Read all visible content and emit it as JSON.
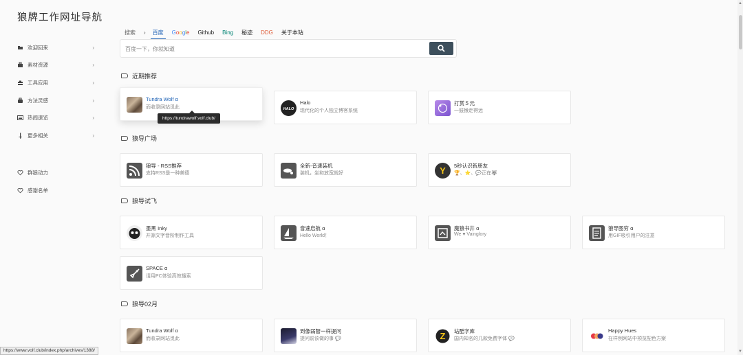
{
  "site": {
    "title": "狼牌工作网址导航"
  },
  "sidebar": {
    "items": [
      {
        "label": "欢迎回来",
        "icon": "bookmark-icon"
      },
      {
        "label": "素材资源",
        "icon": "briefcase-icon"
      },
      {
        "label": "工具应用",
        "icon": "toolbox-icon"
      },
      {
        "label": "方法灵感",
        "icon": "briefcase-icon"
      },
      {
        "label": "热闻速览",
        "icon": "list-icon"
      },
      {
        "label": "更多相关",
        "icon": "sword-icon"
      }
    ],
    "links": [
      {
        "label": "群狼动力",
        "icon": "heart-icon"
      },
      {
        "label": "感谢名单",
        "icon": "heart-icon"
      }
    ],
    "chevron": "›"
  },
  "search": {
    "lead": "搜索",
    "sep": "›",
    "tabs": [
      "百度",
      "Google",
      "Github",
      "Bing",
      "秘迹",
      "DDG",
      "关于本站"
    ],
    "placeholder": "百度一下，你就知道"
  },
  "sections": [
    {
      "title": "近期推荐",
      "cards": [
        {
          "title": "Tundra Wolf α",
          "desc": "而收录网站觅此",
          "icon": "wolf-photo-icon"
        },
        {
          "title": "Halo",
          "desc": "现代化的个人独立博客系统",
          "icon": "halo-icon"
        },
        {
          "title": "打赏５元",
          "desc": "一鼓猴走得远",
          "icon": "gift-icon"
        }
      ]
    },
    {
      "title": "狼导广场",
      "cards": [
        {
          "title": "狼导 - RSS推荐",
          "desc": "支持RSS是一种美德",
          "icon": "rss-icon"
        },
        {
          "title": "全新-音速装机",
          "desc": "装机，坐和放宽就好",
          "icon": "fan-icon"
        },
        {
          "title": "5秒认识新朋友",
          "desc": "🏆、⭐、💬正在🐺",
          "icon": "y-icon"
        }
      ]
    },
    {
      "title": "狼导试飞",
      "cards": [
        {
          "title": "墨黑 Inky",
          "desc": "开源文字音阶制作工具",
          "icon": "inky-icon"
        },
        {
          "title": "音速启航 α",
          "desc": "Hello World！",
          "icon": "sail-icon"
        },
        {
          "title": "魔狼书井 α",
          "desc": "We ♥ Vainglory",
          "icon": "book-icon"
        },
        {
          "title": "狼导图穷 α",
          "desc": "用GIF吸引用户的注意",
          "icon": "doc-icon"
        },
        {
          "title": "SPACE α",
          "desc": "请用PC体验高效搜索",
          "icon": "rocket-icon"
        }
      ]
    },
    {
      "title": "狼导02月",
      "cards": [
        {
          "title": "Tundra Wolf α",
          "desc": "而收录网站觅此",
          "icon": "wolf-photo-icon"
        },
        {
          "title": "到像弱智一样提问",
          "desc": "提问前该做的事 💬",
          "icon": "anime-icon"
        },
        {
          "title": "站酷字库",
          "desc": "国内知名的几款免费字体 💬",
          "icon": "z-icon"
        },
        {
          "title": "Happy Hues",
          "desc": "在样例网站中预览配色方案",
          "icon": "hues-icon"
        }
      ]
    }
  ],
  "tooltip": "https://tundrawolf.volf.club/",
  "statusbar": "https://www.volf.club/index.php/archives/1388/",
  "colors": {
    "accent": "#1a5fb4",
    "search_button": "#3d4f5c",
    "google": "#4285f4",
    "ddg": "#de5833",
    "bing": "#008373"
  }
}
